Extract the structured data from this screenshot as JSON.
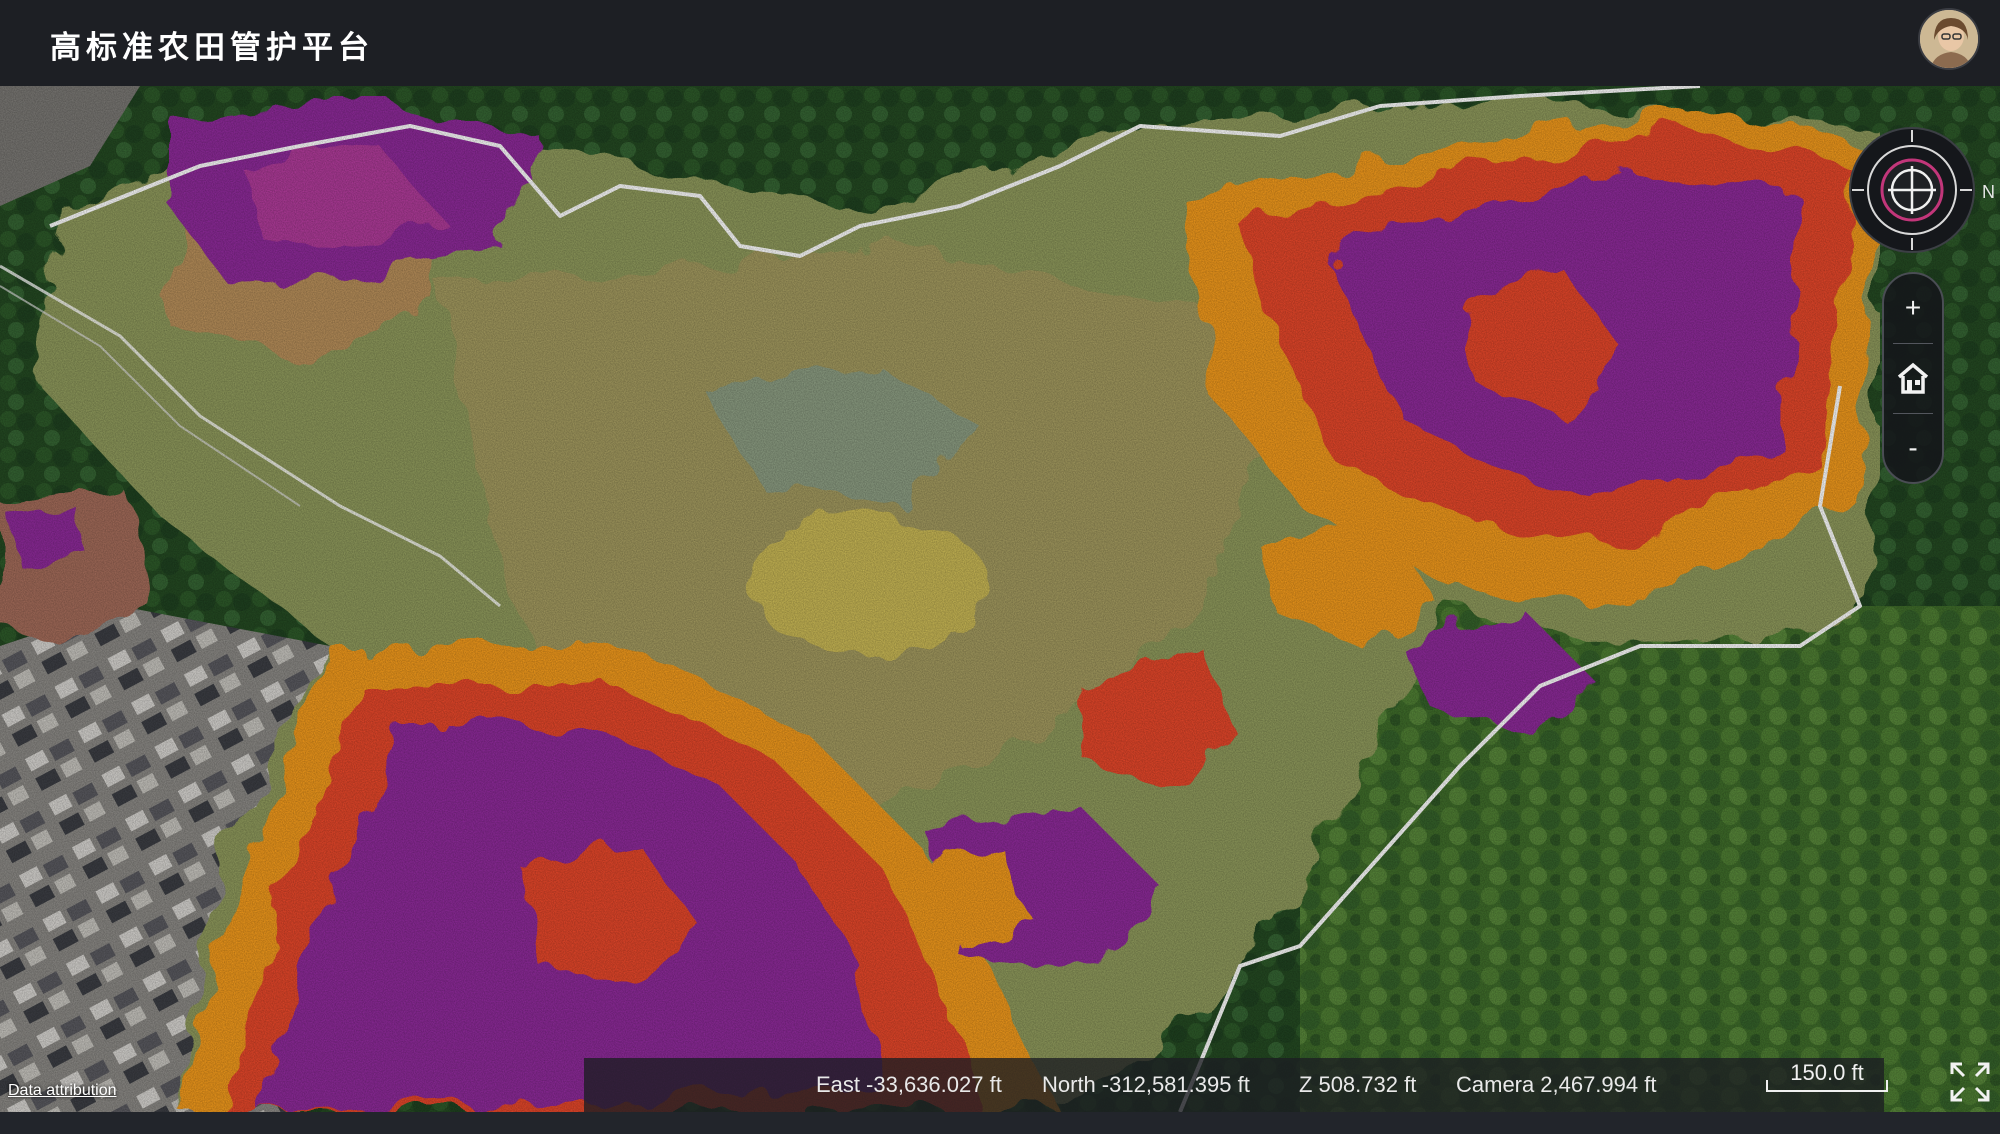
{
  "app": {
    "title": "高标准农田管护平台"
  },
  "map": {
    "navigation": {
      "edge_label": "N",
      "zoom_in_label": "+",
      "zoom_out_label": "-"
    },
    "status": {
      "east_label": "East",
      "east_value": "-33,636.027 ft",
      "north_label": "North",
      "north_value": "-312,581.395 ft",
      "z_label": "Z",
      "z_value": "508.732 ft",
      "camera_label": "Camera",
      "camera_value": "2,467.994 ft"
    },
    "scale": {
      "label": "150.0 ft"
    },
    "attribution": "Data attribution",
    "icons": {
      "compass": "compass-crosshair-icon",
      "home": "home-icon",
      "fullscreen": "fullscreen-icon"
    },
    "colors": {
      "high": "#8e2a9a",
      "mid_high": "#e6462a",
      "mid": "#f29a1e",
      "low": "#c9c04a",
      "terrain": "#8e9a5a",
      "forest": "#2e5a24",
      "boundary": "#ffffff"
    }
  }
}
